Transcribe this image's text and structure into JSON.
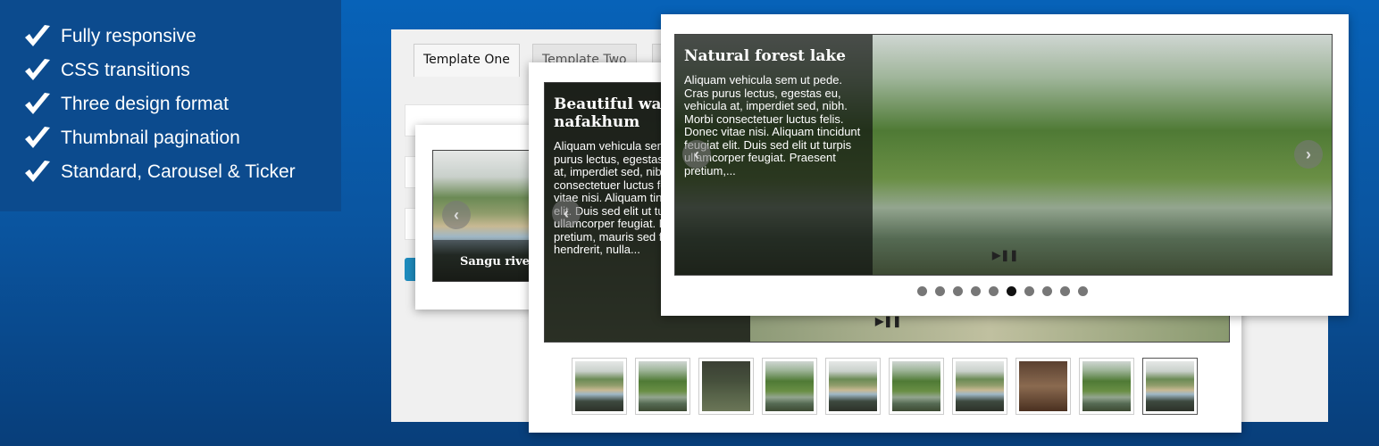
{
  "features": [
    "Fully responsive",
    "CSS transitions",
    "Three design format",
    "Thumbnail pagination",
    "Standard, Carousel & Ticker"
  ],
  "admin": {
    "tabs": [
      "Template One",
      "Template Two"
    ]
  },
  "slider_one": {
    "caption": "Sangu river"
  },
  "slider_two": {
    "title": "Beautiful way nafakhum",
    "text": "Aliquam vehicula sem ut pede. Cras purus lectus, egestas eu, vehicula at, imperdiet sed, nibh. Morbi consectetuer luctus felis. Donec vitae nisi. Aliquam tincidunt feugiat elit. Duis sed elit ut turpis ullamcorper feugiat. Praesent pretium, mauris sed fermentum hendrerit, nulla..."
  },
  "slider_three": {
    "title": "Natural forest lake",
    "text": "Aliquam vehicula sem ut pede. Cras purus lectus, egestas eu, vehicula at, imperdiet sed, nibh. Morbi consectetuer luctus felis. Donec vitae nisi. Aliquam tincidunt feugiat elit. Duis sed elit ut turpis ullamcorper feugiat. Praesent pretium,...",
    "dots": 10,
    "active_dot": 6
  },
  "thumbnails": {
    "count": 10,
    "active": 10
  },
  "icons": {
    "check": "check-icon",
    "prev": "chevron-left-icon",
    "next": "chevron-right-icon",
    "play": "play-icon",
    "pause": "pause-icon"
  }
}
